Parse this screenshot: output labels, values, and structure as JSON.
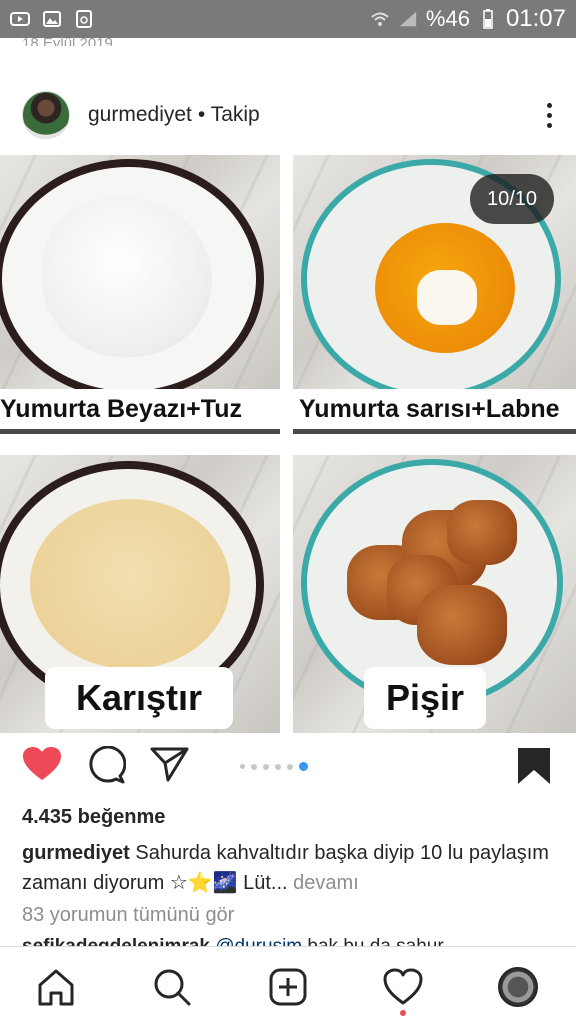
{
  "status_bar": {
    "battery": "%46",
    "time": "01:07",
    "left_icons": [
      "youtube-icon",
      "image-icon",
      "recycle-icon"
    ]
  },
  "post": {
    "date": "18 Eylül 2019",
    "username": "gurmediyet",
    "follow_label": "• Takip",
    "counter": "10/10",
    "image_captions": {
      "top_left": "Yumurta Beyazı+Tuz",
      "top_right": "Yumurta sarısı+Labne",
      "bottom_left": "Karıştır",
      "bottom_right": "Pişir"
    },
    "carousel": {
      "total": 6,
      "active": 6
    },
    "likes": "4.435 beğenme",
    "caption_user": "gurmediyet",
    "caption_text": " Sahurda kahvaltıdır başka diyip 10 lu paylaşım zamanı diyorum ☆⭐🌌 Lüt...",
    "caption_more": " devamı",
    "view_comments": "83 yorumun tümünü gör",
    "comment_user": "sefikadegdelenimrak",
    "comment_mention": " @durusim",
    "comment_text": " bak bu da sahur"
  },
  "colors": {
    "like": "#ed4956",
    "dot_active": "#3897f0"
  }
}
